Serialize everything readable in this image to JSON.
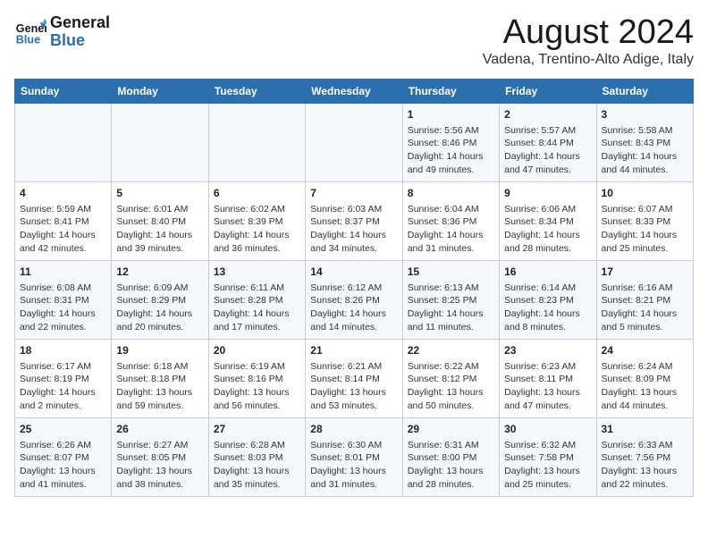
{
  "header": {
    "logo_line1": "General",
    "logo_line2": "Blue",
    "month_year": "August 2024",
    "location": "Vadena, Trentino-Alto Adige, Italy"
  },
  "weekdays": [
    "Sunday",
    "Monday",
    "Tuesday",
    "Wednesday",
    "Thursday",
    "Friday",
    "Saturday"
  ],
  "weeks": [
    [
      {
        "day": "",
        "info": ""
      },
      {
        "day": "",
        "info": ""
      },
      {
        "day": "",
        "info": ""
      },
      {
        "day": "",
        "info": ""
      },
      {
        "day": "1",
        "info": "Sunrise: 5:56 AM\nSunset: 8:46 PM\nDaylight: 14 hours\nand 49 minutes."
      },
      {
        "day": "2",
        "info": "Sunrise: 5:57 AM\nSunset: 8:44 PM\nDaylight: 14 hours\nand 47 minutes."
      },
      {
        "day": "3",
        "info": "Sunrise: 5:58 AM\nSunset: 8:43 PM\nDaylight: 14 hours\nand 44 minutes."
      }
    ],
    [
      {
        "day": "4",
        "info": "Sunrise: 5:59 AM\nSunset: 8:41 PM\nDaylight: 14 hours\nand 42 minutes."
      },
      {
        "day": "5",
        "info": "Sunrise: 6:01 AM\nSunset: 8:40 PM\nDaylight: 14 hours\nand 39 minutes."
      },
      {
        "day": "6",
        "info": "Sunrise: 6:02 AM\nSunset: 8:39 PM\nDaylight: 14 hours\nand 36 minutes."
      },
      {
        "day": "7",
        "info": "Sunrise: 6:03 AM\nSunset: 8:37 PM\nDaylight: 14 hours\nand 34 minutes."
      },
      {
        "day": "8",
        "info": "Sunrise: 6:04 AM\nSunset: 8:36 PM\nDaylight: 14 hours\nand 31 minutes."
      },
      {
        "day": "9",
        "info": "Sunrise: 6:06 AM\nSunset: 8:34 PM\nDaylight: 14 hours\nand 28 minutes."
      },
      {
        "day": "10",
        "info": "Sunrise: 6:07 AM\nSunset: 8:33 PM\nDaylight: 14 hours\nand 25 minutes."
      }
    ],
    [
      {
        "day": "11",
        "info": "Sunrise: 6:08 AM\nSunset: 8:31 PM\nDaylight: 14 hours\nand 22 minutes."
      },
      {
        "day": "12",
        "info": "Sunrise: 6:09 AM\nSunset: 8:29 PM\nDaylight: 14 hours\nand 20 minutes."
      },
      {
        "day": "13",
        "info": "Sunrise: 6:11 AM\nSunset: 8:28 PM\nDaylight: 14 hours\nand 17 minutes."
      },
      {
        "day": "14",
        "info": "Sunrise: 6:12 AM\nSunset: 8:26 PM\nDaylight: 14 hours\nand 14 minutes."
      },
      {
        "day": "15",
        "info": "Sunrise: 6:13 AM\nSunset: 8:25 PM\nDaylight: 14 hours\nand 11 minutes."
      },
      {
        "day": "16",
        "info": "Sunrise: 6:14 AM\nSunset: 8:23 PM\nDaylight: 14 hours\nand 8 minutes."
      },
      {
        "day": "17",
        "info": "Sunrise: 6:16 AM\nSunset: 8:21 PM\nDaylight: 14 hours\nand 5 minutes."
      }
    ],
    [
      {
        "day": "18",
        "info": "Sunrise: 6:17 AM\nSunset: 8:19 PM\nDaylight: 14 hours\nand 2 minutes."
      },
      {
        "day": "19",
        "info": "Sunrise: 6:18 AM\nSunset: 8:18 PM\nDaylight: 13 hours\nand 59 minutes."
      },
      {
        "day": "20",
        "info": "Sunrise: 6:19 AM\nSunset: 8:16 PM\nDaylight: 13 hours\nand 56 minutes."
      },
      {
        "day": "21",
        "info": "Sunrise: 6:21 AM\nSunset: 8:14 PM\nDaylight: 13 hours\nand 53 minutes."
      },
      {
        "day": "22",
        "info": "Sunrise: 6:22 AM\nSunset: 8:12 PM\nDaylight: 13 hours\nand 50 minutes."
      },
      {
        "day": "23",
        "info": "Sunrise: 6:23 AM\nSunset: 8:11 PM\nDaylight: 13 hours\nand 47 minutes."
      },
      {
        "day": "24",
        "info": "Sunrise: 6:24 AM\nSunset: 8:09 PM\nDaylight: 13 hours\nand 44 minutes."
      }
    ],
    [
      {
        "day": "25",
        "info": "Sunrise: 6:26 AM\nSunset: 8:07 PM\nDaylight: 13 hours\nand 41 minutes."
      },
      {
        "day": "26",
        "info": "Sunrise: 6:27 AM\nSunset: 8:05 PM\nDaylight: 13 hours\nand 38 minutes."
      },
      {
        "day": "27",
        "info": "Sunrise: 6:28 AM\nSunset: 8:03 PM\nDaylight: 13 hours\nand 35 minutes."
      },
      {
        "day": "28",
        "info": "Sunrise: 6:30 AM\nSunset: 8:01 PM\nDaylight: 13 hours\nand 31 minutes."
      },
      {
        "day": "29",
        "info": "Sunrise: 6:31 AM\nSunset: 8:00 PM\nDaylight: 13 hours\nand 28 minutes."
      },
      {
        "day": "30",
        "info": "Sunrise: 6:32 AM\nSunset: 7:58 PM\nDaylight: 13 hours\nand 25 minutes."
      },
      {
        "day": "31",
        "info": "Sunrise: 6:33 AM\nSunset: 7:56 PM\nDaylight: 13 hours\nand 22 minutes."
      }
    ]
  ]
}
